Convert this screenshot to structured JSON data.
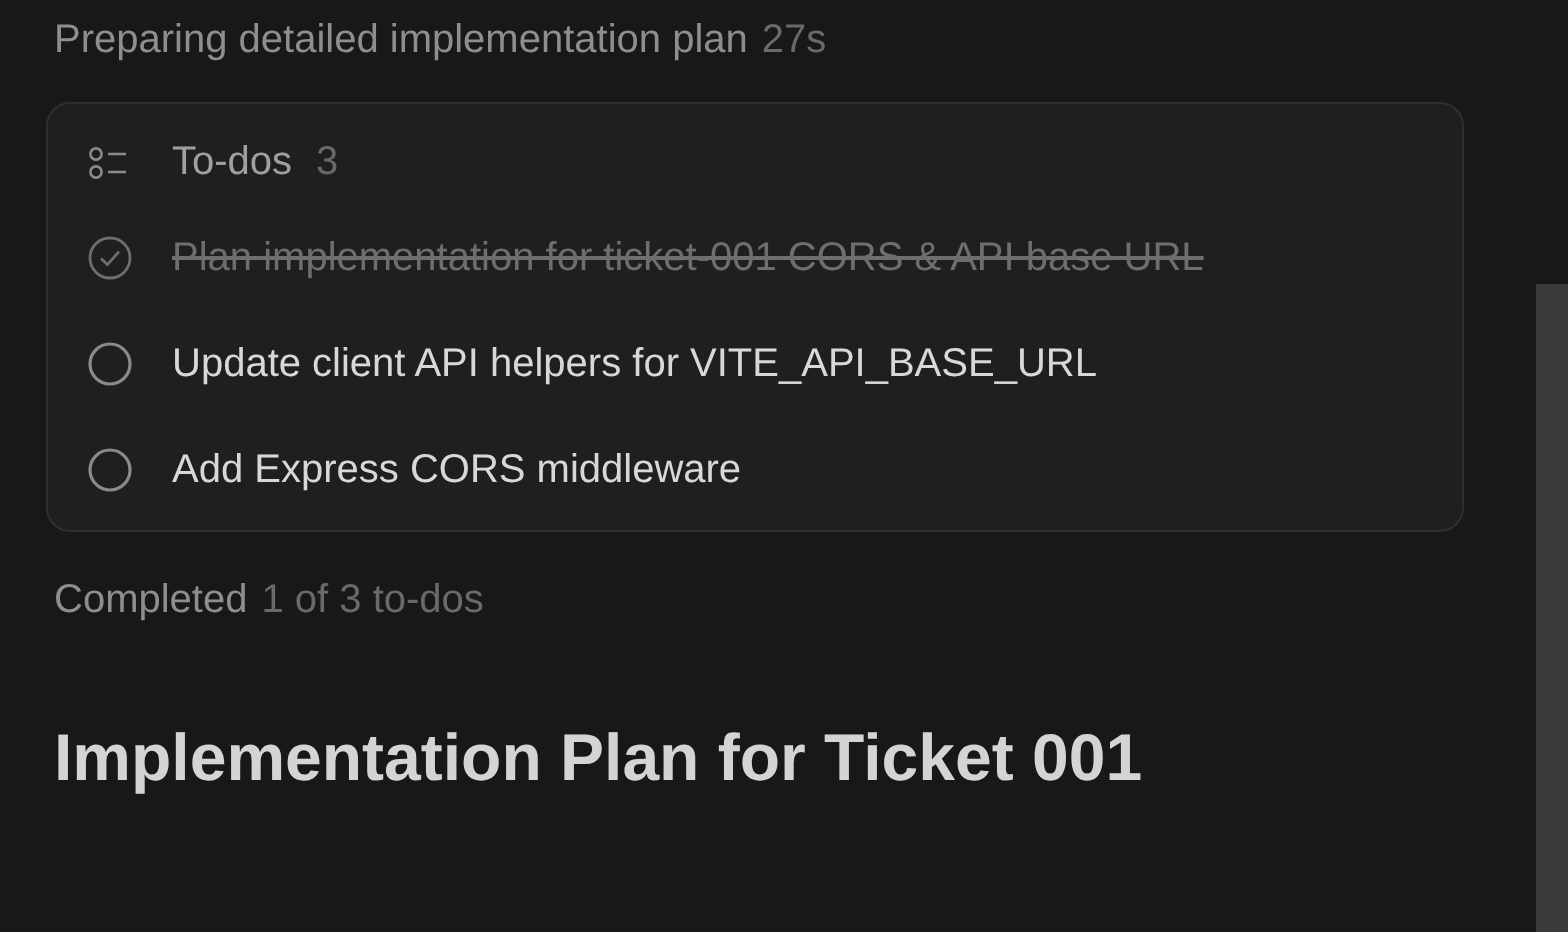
{
  "status": {
    "label": "Preparing detailed implementation plan",
    "elapsed": "27s"
  },
  "todos": {
    "title": "To-dos",
    "count": "3",
    "items": [
      {
        "text": "Plan implementation for ticket-001 CORS & API base URL",
        "checked": true
      },
      {
        "text": "Update client API helpers for VITE_API_BASE_URL",
        "checked": false
      },
      {
        "text": "Add Express CORS middleware",
        "checked": false
      }
    ]
  },
  "summary": {
    "label": "Completed",
    "detail": "1 of 3 to-dos"
  },
  "heading": "Implementation Plan for Ticket 001"
}
